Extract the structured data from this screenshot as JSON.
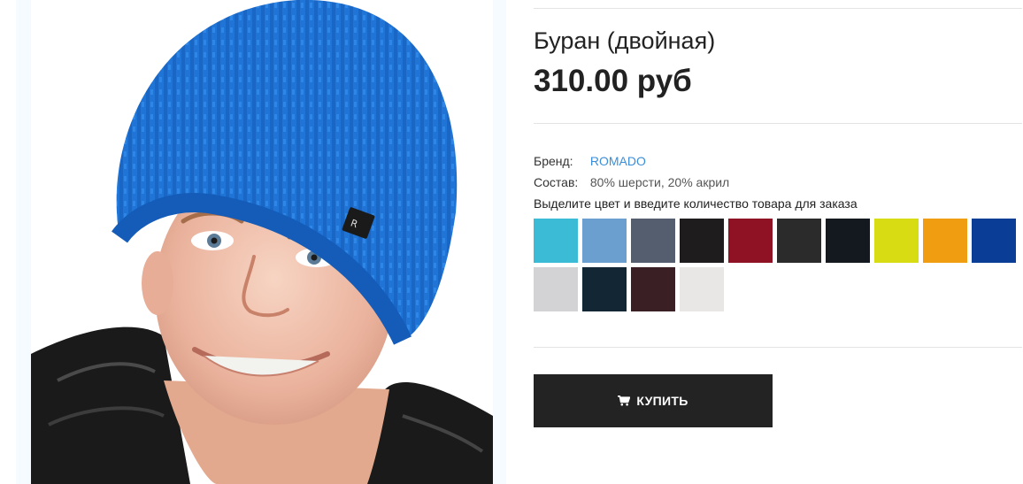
{
  "product": {
    "title": "Буран (двойная)",
    "price": "310.00 руб",
    "attributes": {
      "brand_label": "Бренд:",
      "brand_value": "ROMADO",
      "composition_label": "Состав:",
      "composition_value": "80% шерсти, 20% акрил"
    },
    "instruction": "Выделите цвет и введите количество товара для заказа",
    "colors": [
      "#3bbbd6",
      "#6a9fd0",
      "#555e6e",
      "#1e1c1c",
      "#8e1124",
      "#2b2b2c",
      "#13191f",
      "#d7dd12",
      "#f09d12",
      "#0a3d95",
      "#d3d3d6",
      "#132634",
      "#3a1f24",
      "#e9e6e6"
    ],
    "image_icon": "product-photo-icon",
    "label_icon": "brand-label-icon"
  },
  "buy_button": {
    "label": "КУПИТЬ",
    "icon": "cart-icon"
  }
}
